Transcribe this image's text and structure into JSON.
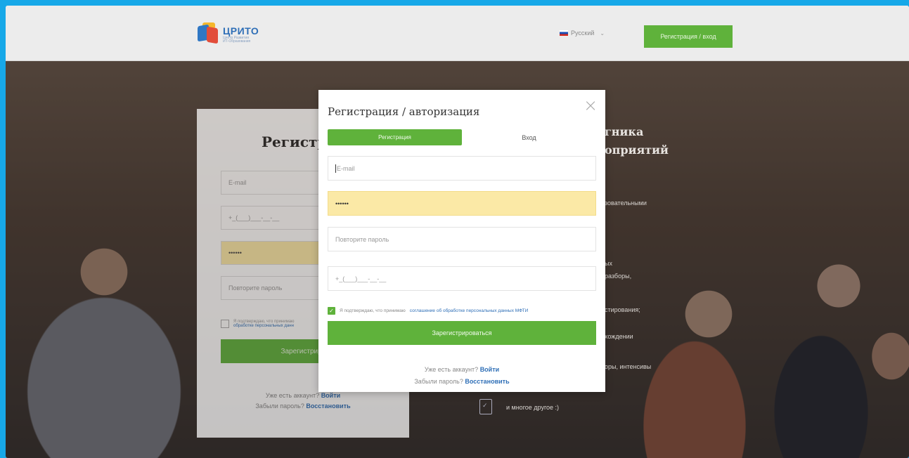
{
  "header": {
    "logo_title": "ЦРИТО",
    "logo_sub1": "Центр Развития",
    "logo_sub2": "ИТ-Образования",
    "language": "Русский",
    "register_login_button": "Регистрация / вход"
  },
  "background_form": {
    "title": "Регистра",
    "email_placeholder": "E-mail",
    "phone_placeholder": "+_(___)___-__-__",
    "password_value": "••••••",
    "repeat_password_placeholder": "Повторите пароль",
    "consent_text_1": "Я подтверждаю, что принимаю",
    "consent_text_2": "обработке персональных данн",
    "submit_label": "Зарегистриров",
    "have_account": "Уже есть аккаунт?",
    "login_link": "Войти",
    "forgot_password": "Забыли пароль?",
    "restore_link": "Восстановить"
  },
  "background_right": {
    "heading_line1": "гника",
    "heading_line2": "оприятий",
    "item1": "зовательными",
    "item2a": "ых",
    "item2b": "разборы,",
    "item3": "стирования;",
    "item4": "хождении",
    "item5": "оры, интенсивы",
    "item6": "и многое другое :)"
  },
  "modal": {
    "title": "Регистрация / авторизация",
    "tab_register": "Регистрация",
    "tab_login": "Вход",
    "email_placeholder": "E-mail",
    "password_value": "••••••",
    "repeat_password_placeholder": "Повторите пароль",
    "phone_placeholder": "+_(___)___-__-__",
    "consent_prefix": "Я подтверждаю, что принимаю",
    "consent_link": "соглашение об обработке персональных данных МФТИ",
    "submit_label": "Зарегистрироваться",
    "have_account": "Уже есть аккаунт?",
    "login_link": "Войти",
    "forgot_password": "Забыли пароль?",
    "restore_link": "Восстановить"
  },
  "colors": {
    "accent_green": "#5fb23b",
    "link_blue": "#2f6fb7",
    "autofill_yellow": "#fbe9a6",
    "frame_blue": "#17a8e8"
  },
  "icons": [
    "close-icon",
    "checkbox-checked-icon",
    "russia-flag-icon",
    "chevron-down-icon",
    "clipboard-check-icon"
  ]
}
